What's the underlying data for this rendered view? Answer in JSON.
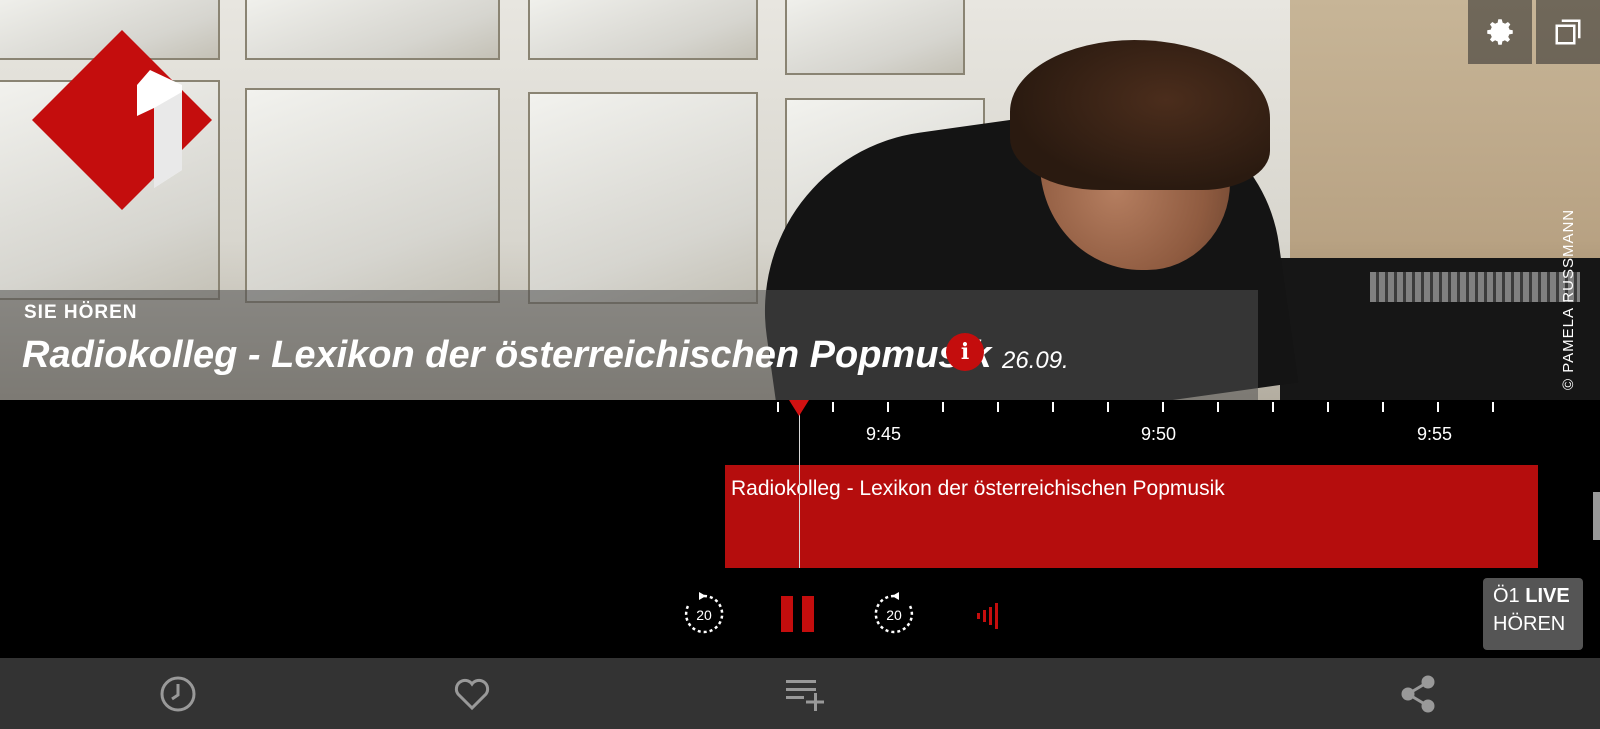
{
  "hero": {
    "now_label": "SIE HÖREN",
    "program_title": "Radiokolleg - Lexikon der österreichischen Popmusik",
    "date": "26.09.",
    "info_icon": "i",
    "photo_credit": "© PAMELA RUSSMANN",
    "logo_icon": "oe1-logo-icon",
    "settings_icon": "gear-icon",
    "popout_icon": "popout-window-icon",
    "accent_color": "#c40d0d"
  },
  "timeline": {
    "time_labels": [
      "9:45",
      "9:50",
      "9:55"
    ],
    "program_block_title": "Radiokolleg - Lexikon der österreichischen Popmusik",
    "program_color": "#b50d0d"
  },
  "player": {
    "rewind_label": "20",
    "forward_label": "20",
    "rewind_icon": "rewind-20-icon",
    "pause_icon": "pause-icon",
    "forward_icon": "forward-20-icon",
    "volume_icon": "volume-bars-icon",
    "live_station": "Ö1",
    "live_word": "LIVE",
    "live_action": "HÖREN"
  },
  "toolbar": {
    "items": [
      "history-icon",
      "heart-icon",
      "add-to-playlist-icon",
      "share-icon"
    ]
  }
}
